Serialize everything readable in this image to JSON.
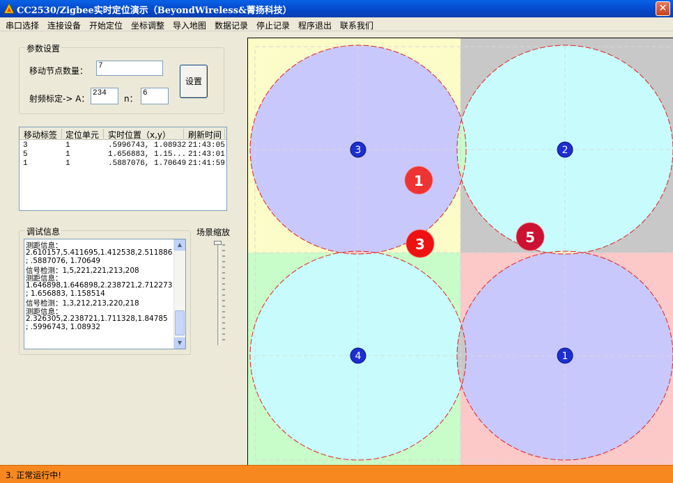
{
  "window": {
    "title": "CC2530/Zigbee实时定位演示（BeyondWireless&菁扬科技）",
    "close_glyph": "✕"
  },
  "menu": {
    "items": [
      "串口选择",
      "连接设备",
      "开始定位",
      "坐标调整",
      "导入地图",
      "数据记录",
      "停止记录",
      "程序退出",
      "联系我们"
    ]
  },
  "params": {
    "legend": "参数设置",
    "mobile_count_label": "移动节点数量：",
    "mobile_count_value": "7",
    "rf_label": "射频标定-> A：",
    "a_value": "234",
    "n_label": "n：",
    "n_value": "6",
    "set_button": "设置"
  },
  "table": {
    "columns": [
      "移动标签",
      "定位单元",
      "实时位置（x,y）",
      "刷新时间"
    ],
    "rows": [
      [
        "3",
        "1",
        ".5996743, 1.08932",
        "21:43:05"
      ],
      [
        "5",
        "1",
        "1.656883, 1.15...",
        "21:43:01"
      ],
      [
        "1",
        "1",
        ".5887076, 1.70649",
        "21:41:59"
      ]
    ]
  },
  "debug": {
    "legend": "调试信息",
    "lines": [
      "测距信息：",
      "2.610157,5.411695,1.412538,2.511886",
      "; .5887076, 1.70649",
      "信号检测：1,5,221,221,213,208",
      "测距信息：",
      "1.646898,1.646898,2.238721,2.712273",
      "; 1.656883, 1.158514",
      "信号检测：1,3,212,213,220,218",
      "测距信息：",
      "2.326305,2.238721,1.711328,1.84785",
      "; .5996743, 1.08932"
    ],
    "scroll_up": "▲",
    "scroll_down": "▼"
  },
  "zoom": {
    "label": "场景缩放"
  },
  "map": {
    "colors": {
      "yellow": "#fcfcc8",
      "lavender": "#c8c8fc",
      "gray": "#c8c8c8",
      "cyan": "#c8fcfc",
      "pink": "#fcc8c8",
      "green": "#c8fcc8",
      "white": "#ffffff",
      "anchor": "#1c2fd0",
      "tag_red": "#ee2222",
      "tag_dark": "#cc1133",
      "circle_stroke": "#dd2222"
    },
    "anchors": [
      "1",
      "2",
      "3",
      "4"
    ],
    "tags": [
      "1",
      "3",
      "5"
    ]
  },
  "status": {
    "text": "3. 正常运行中!"
  }
}
